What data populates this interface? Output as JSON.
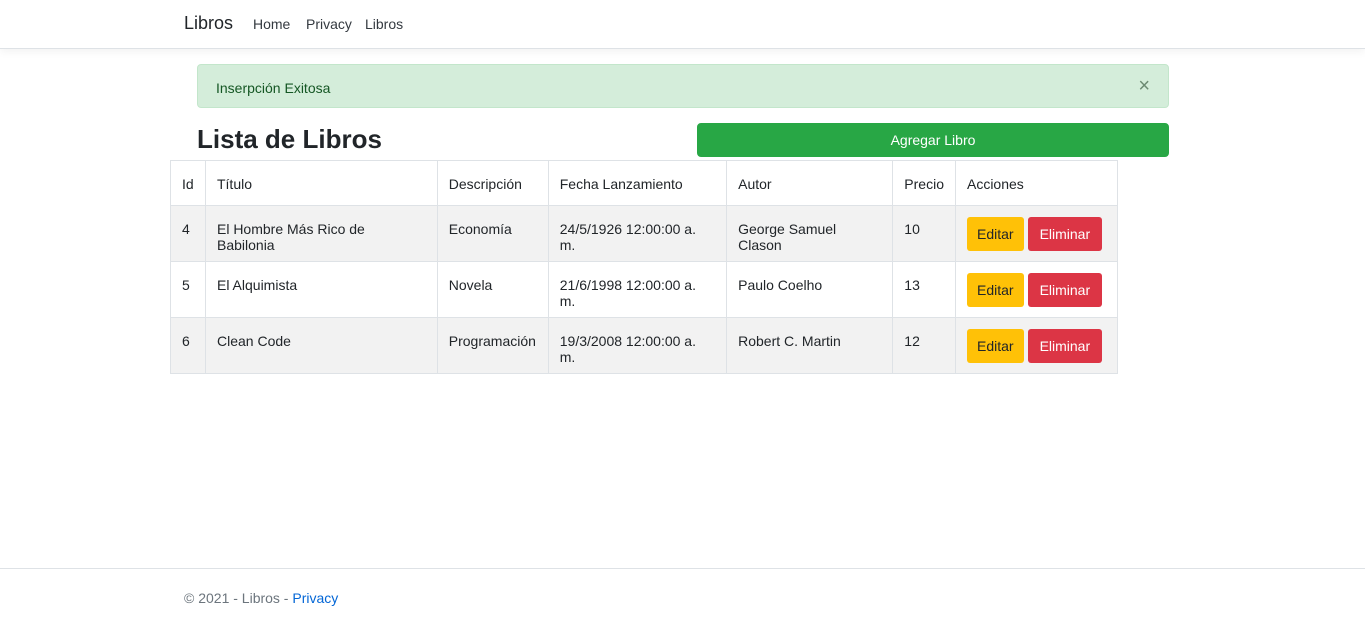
{
  "navbar": {
    "brand": "Libros",
    "links": [
      "Home",
      "Privacy",
      "Libros"
    ]
  },
  "alert": {
    "message": "Inserpción Exitosa",
    "close": "×"
  },
  "main": {
    "title": "Lista de Libros",
    "add_button": "Agregar Libro"
  },
  "table": {
    "headers": [
      "Id",
      "Título",
      "Descripción",
      "Fecha Lanzamiento",
      "Autor",
      "Precio",
      "Acciones"
    ],
    "rows": [
      [
        "4",
        "El Hombre Más Rico de Babilonia",
        "Economía",
        "24/5/1926 12:00:00 a. m.",
        "George Samuel Clason",
        "10"
      ],
      [
        "5",
        "El Alquimista",
        "Novela",
        "21/6/1998 12:00:00 a. m.",
        "Paulo Coelho",
        "13"
      ],
      [
        "6",
        "Clean Code",
        "Programación",
        "19/3/2008 12:00:00 a. m.",
        "Robert C. Martin",
        "12"
      ]
    ],
    "edit_label": "Editar",
    "delete_label": "Eliminar"
  },
  "footer": {
    "text": "© 2021 - Libros - ",
    "link": "Privacy"
  },
  "colors": {
    "success": "#28a745",
    "warning": "#ffc107",
    "danger": "#dc3545",
    "link": "#0366d6"
  }
}
